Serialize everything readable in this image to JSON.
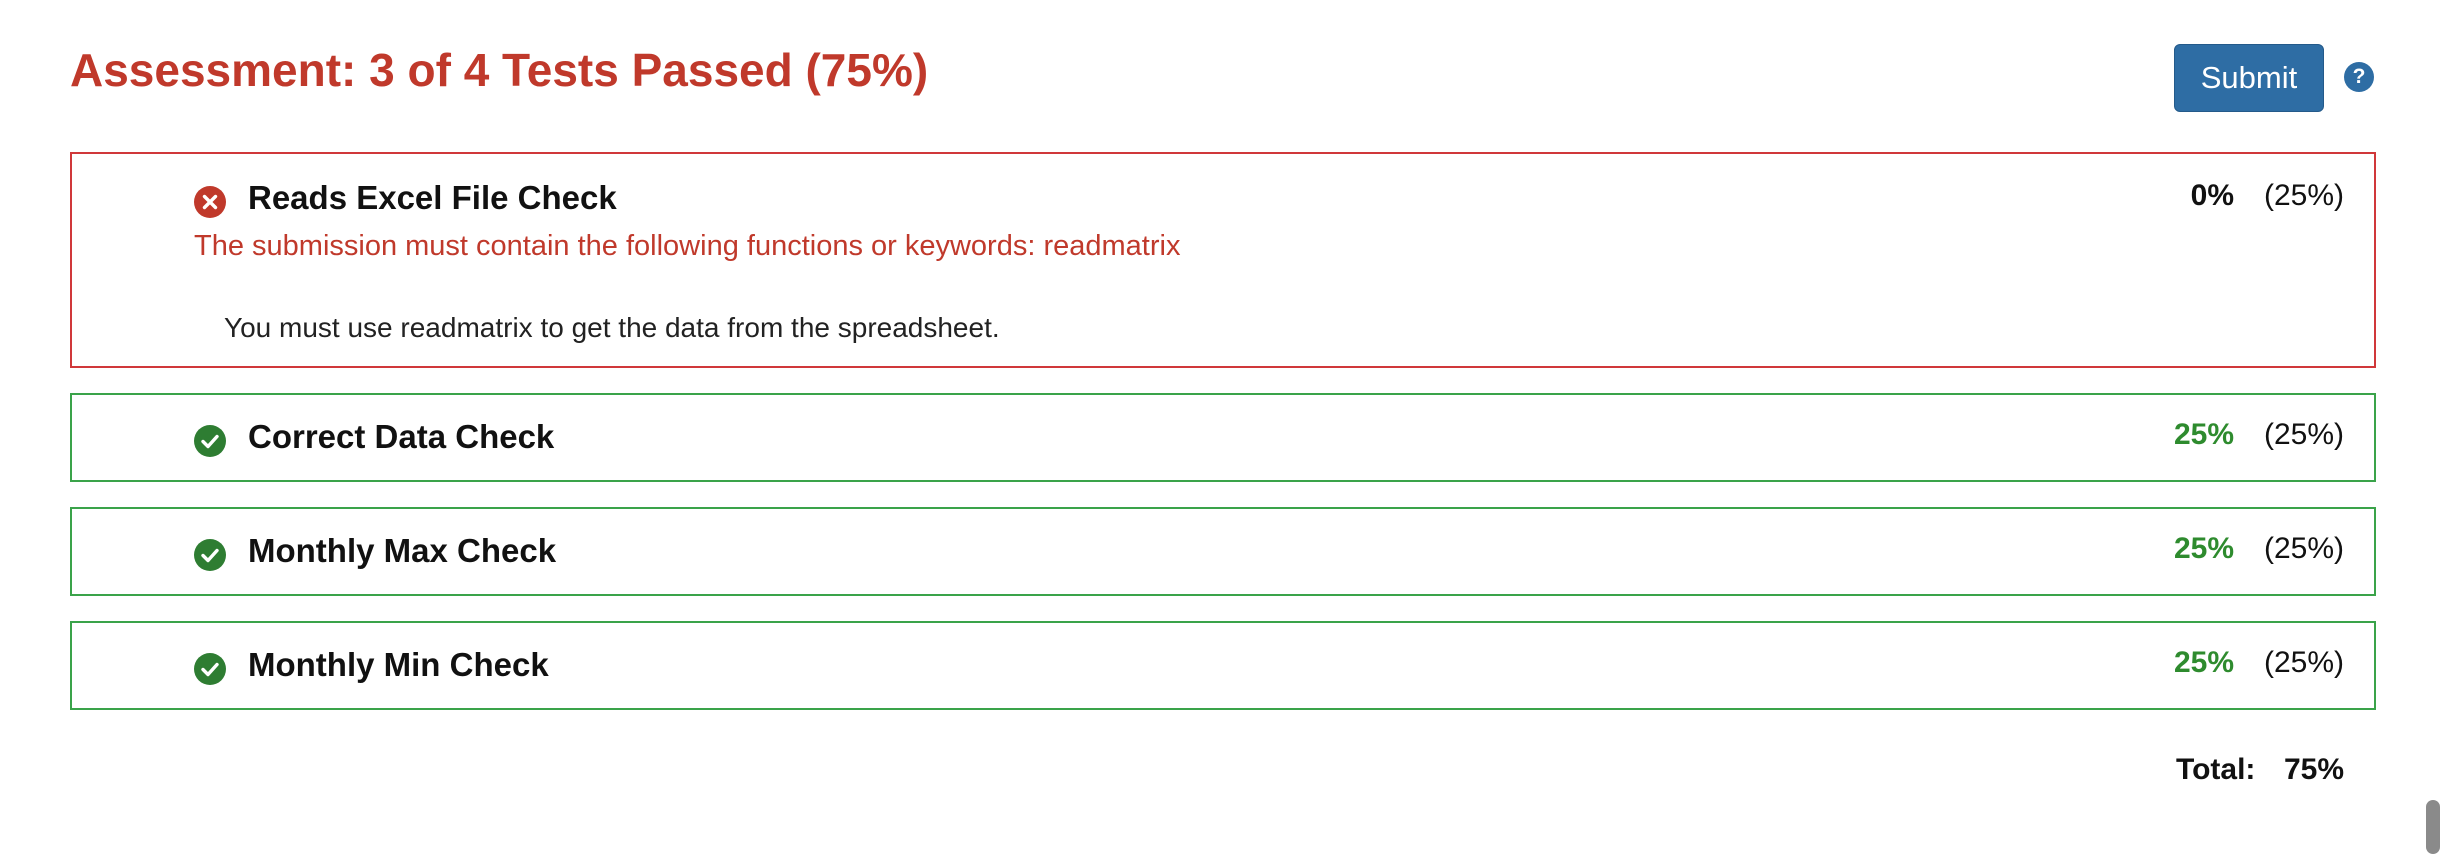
{
  "header": {
    "title": "Assessment: 3 of 4 Tests Passed (75%)",
    "submit_label": "Submit",
    "help_symbol": "?"
  },
  "colors": {
    "fail": "#c0392b",
    "pass": "#2e8b2e",
    "accent": "#2e6da4"
  },
  "tests": [
    {
      "name": "Reads Excel File Check",
      "status": "fail",
      "icon": "x-circle-icon",
      "score": "0%",
      "weight": "(25%)",
      "error": "The submission must contain the following functions or keywords: readmatrix",
      "hint": "You must use readmatrix to get the data from the spreadsheet."
    },
    {
      "name": "Correct Data Check",
      "status": "pass",
      "icon": "check-circle-icon",
      "score": "25%",
      "weight": "(25%)"
    },
    {
      "name": "Monthly Max Check",
      "status": "pass",
      "icon": "check-circle-icon",
      "score": "25%",
      "weight": "(25%)"
    },
    {
      "name": "Monthly Min Check",
      "status": "pass",
      "icon": "check-circle-icon",
      "score": "25%",
      "weight": "(25%)"
    }
  ],
  "total": {
    "label": "Total:",
    "value": "75%"
  }
}
